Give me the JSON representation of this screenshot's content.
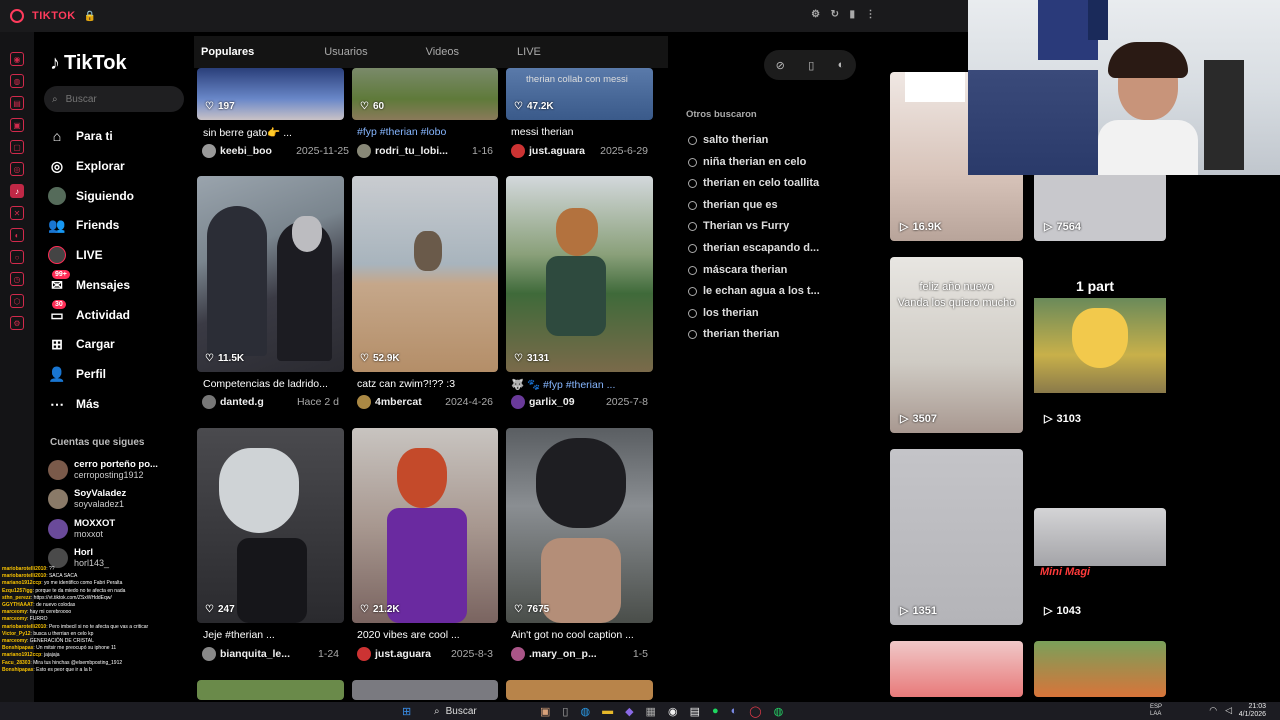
{
  "browser": {
    "title": "TIKTOK"
  },
  "sidebar": {
    "brand": "TikTok",
    "search_placeholder": "Buscar",
    "nav": [
      {
        "label": "Para ti",
        "icon": "home-icon"
      },
      {
        "label": "Explorar",
        "icon": "compass-icon"
      },
      {
        "label": "Siguiendo",
        "icon": "following-icon"
      },
      {
        "label": "Friends",
        "icon": "friends-icon"
      },
      {
        "label": "LIVE",
        "icon": "live-icon"
      },
      {
        "label": "Mensajes",
        "icon": "messages-icon",
        "badge": "99+"
      },
      {
        "label": "Actividad",
        "icon": "activity-icon",
        "badge": "30"
      },
      {
        "label": "Cargar",
        "icon": "upload-icon"
      },
      {
        "label": "Perfil",
        "icon": "profile-icon"
      },
      {
        "label": "Más",
        "icon": "more-icon"
      }
    ],
    "following_title": "Cuentas que sigues",
    "accounts": [
      {
        "name": "cerro porteño po...",
        "handle": "cerroposting1912"
      },
      {
        "name": "SoyValadez",
        "handle": "soyvaladez1"
      },
      {
        "name": "MOXXOT",
        "handle": "moxxot"
      },
      {
        "name": "Horl",
        "handle": "horl143_"
      }
    ]
  },
  "tabs": [
    "Populares",
    "Usuarios",
    "Videos",
    "LIVE"
  ],
  "videos": [
    {
      "likes": "197",
      "caption": "sin berre gato👉 ...",
      "user": "keebi_boo",
      "date": "2025-11-25"
    },
    {
      "likes": "60",
      "caption": "#fyp #therian #lobo",
      "user": "rodri_tu_lobi...",
      "date": "1-16",
      "hashtag": true
    },
    {
      "likes": "47.2K",
      "caption": "messi therian",
      "user": "just.aguara",
      "date": "2025-6-29",
      "overlay": "therian collab con messi"
    },
    {
      "likes": "11.5K",
      "caption": "Competencias de ladrido...",
      "user": "danted.g",
      "date": "Hace 2 d"
    },
    {
      "likes": "52.9K",
      "caption": "catz can zwim?!?? :3",
      "user": "4mbercat",
      "date": "2024-4-26"
    },
    {
      "likes": "3131",
      "caption": "🐺 🐾 #fyp #therian ...",
      "user": "garlix_09",
      "date": "2025-7-8",
      "hashtag": true
    },
    {
      "likes": "247",
      "caption": "Jeje #therian ...",
      "user": "bianquita_le...",
      "date": "1-24",
      "hashtag": true
    },
    {
      "likes": "21.2K",
      "caption": "2020 vibes are cool ...",
      "user": "just.aguara",
      "date": "2025-8-3"
    },
    {
      "likes": "7675",
      "caption": "Ain't got no cool caption ...",
      "user": ".mary_on_p...",
      "date": "1-5"
    }
  ],
  "others_searched": {
    "title": "Otros buscaron",
    "items": [
      "salto therian",
      "niña therian en celo",
      "therian en celo toallita",
      "therian que es",
      "Therian vs Furry",
      "therian escapando d...",
      "máscara therian",
      "le echan agua a los t...",
      "los therian",
      "therian therian"
    ]
  },
  "right_videos": [
    {
      "count": "16.9K"
    },
    {
      "count": "7564"
    },
    {
      "count": "3507",
      "overlay": "feliz año nuevo\nVanda los quiero mucho"
    },
    {
      "count": "3103",
      "overlay": "1 part"
    },
    {
      "count": "1351"
    },
    {
      "count": "1043",
      "overlay": "Mini Magi"
    }
  ],
  "chat": [
    {
      "u": "mariobarotelli2010",
      "t": ": ??"
    },
    {
      "u": "mariobarotelli2010",
      "t": ": SACA SACA"
    },
    {
      "u": "mariano1912ccp",
      "t": ": yo me identifico como Fabri Peralta"
    },
    {
      "u": "Ezqu1257igg",
      "t": ": porque te da miedo no te afecta en nada"
    },
    {
      "u": "sthn_perezz",
      "t": ": https://vt.tiktok.com/ZSxWHddEqw/"
    },
    {
      "u": "GGYTHAAAT",
      "t": ": de nuevo colodas"
    },
    {
      "u": "marceomy",
      "t": ": hay mi cerebroooo"
    },
    {
      "u": "marceomy",
      "t": ": FURRO"
    },
    {
      "u": "mariobarotelli2010",
      "t": ": Pero imbecil si no te afecta que vas a criticar"
    },
    {
      "u": "Victor_Py12",
      "t": ": busca u therrian en celo kp"
    },
    {
      "u": "marceomy",
      "t": ": GENERACIÓN DE CRISTAL"
    },
    {
      "u": "Bonshipapas",
      "t": ": Un mitsir me preocupó su iphone 11"
    },
    {
      "u": "mariano1912ccp",
      "t": ": jajajaja"
    },
    {
      "u": "Facu_28303",
      "t": ": Mira tus hinchas @elsembposting_1912"
    },
    {
      "u": "Bonshipapas",
      "t": ": Esto es peor que ir a la b"
    }
  ],
  "taskbar": {
    "search": "Buscar",
    "lang": "ESP",
    "lang2": "LAA",
    "time": "21:03",
    "date": "4/1/2026"
  },
  "colors": {
    "accent": "#fe2c55",
    "hashtag": "#86b6ff",
    "background": "#000000"
  }
}
